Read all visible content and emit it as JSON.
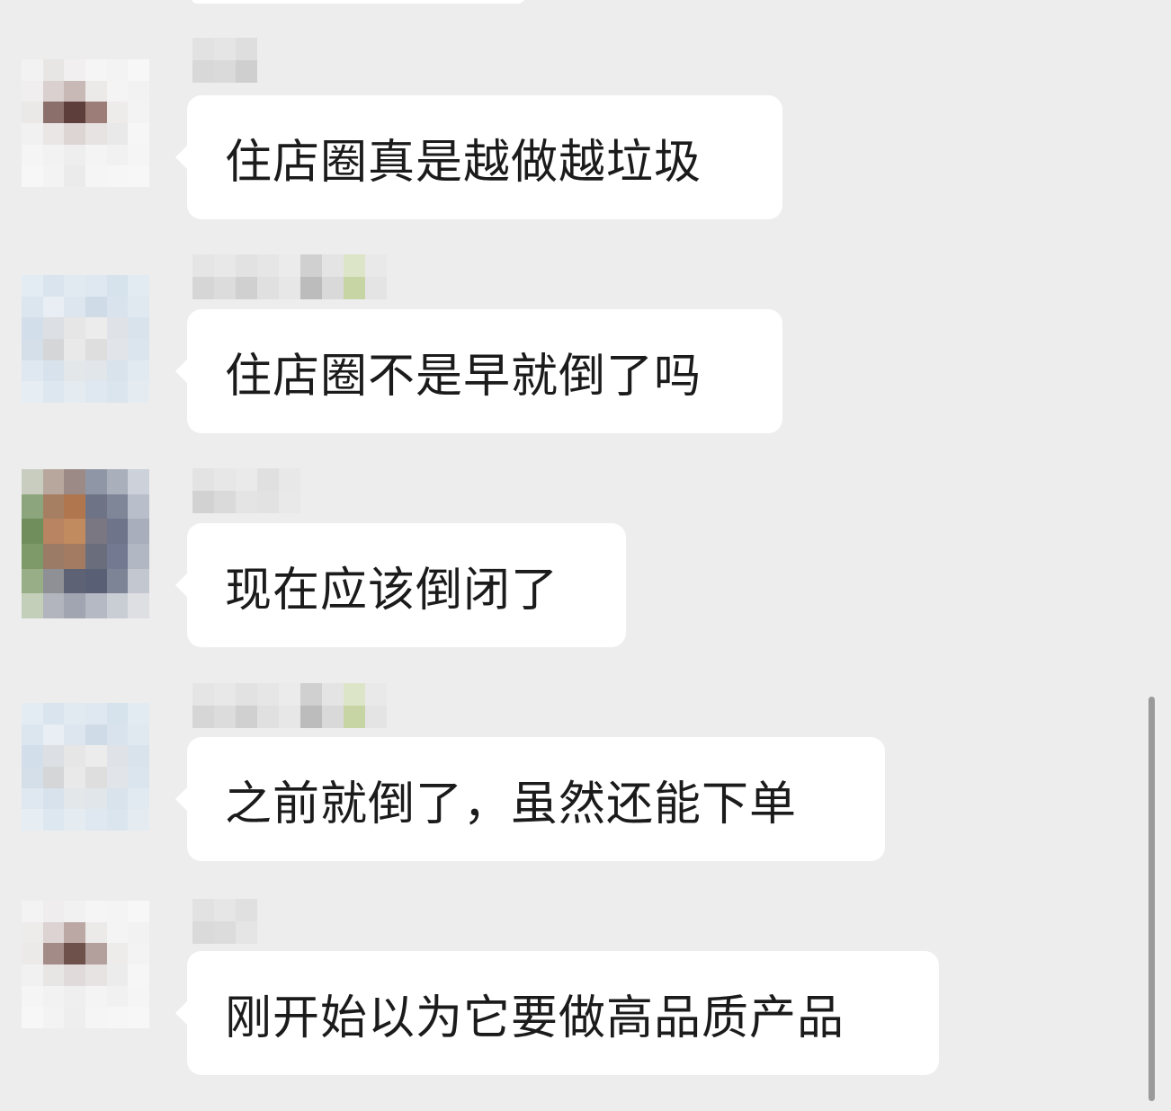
{
  "chat": {
    "messages": [
      {
        "text": "住店圈真是越做越垃圾"
      },
      {
        "text": "住店圈不是早就倒了吗"
      },
      {
        "text": "现在应该倒闭了"
      },
      {
        "text": "之前就倒了，虽然还能下单"
      },
      {
        "text": "刚开始以为它要做高品质产品"
      }
    ]
  },
  "colors": {
    "background": "#ededed",
    "bubble": "#ffffff",
    "text": "#1b1b1b",
    "scrollbar": "#9a9a9a"
  },
  "icons": {
    "avatar": "pixelated-avatar",
    "nickname": "pixelated-nickname"
  }
}
